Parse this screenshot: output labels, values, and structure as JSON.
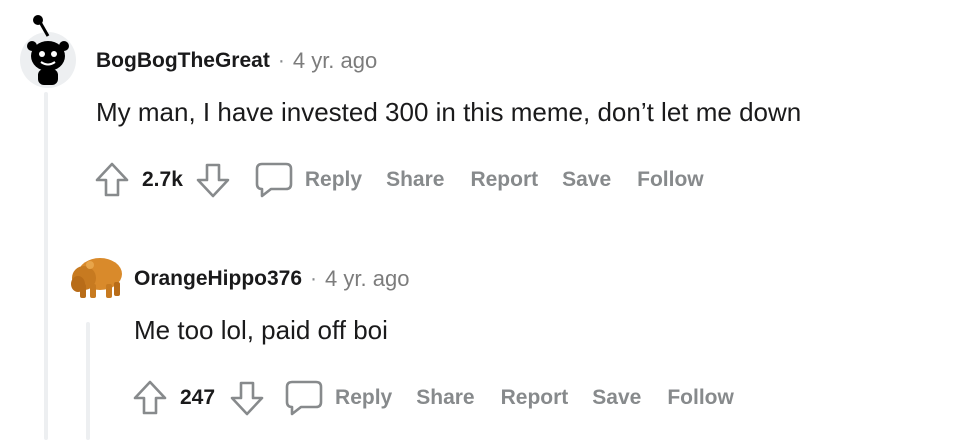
{
  "comments": [
    {
      "username": "BogBogTheGreat",
      "separator": "·",
      "timestamp": "4 yr. ago",
      "body": "My man, I have invested 300 in this meme, don’t let me down",
      "votes": "2.7k",
      "actions": {
        "reply": "Reply",
        "share": "Share",
        "report": "Report",
        "save": "Save",
        "follow": "Follow"
      }
    },
    {
      "username": "OrangeHippo376",
      "separator": "·",
      "timestamp": "4 yr. ago",
      "body": "Me too lol, paid off boi",
      "votes": "247",
      "actions": {
        "reply": "Reply",
        "share": "Share",
        "report": "Report",
        "save": "Save",
        "follow": "Follow"
      }
    }
  ],
  "icons": {
    "upvote": "upvote-arrow-icon",
    "downvote": "downvote-arrow-icon",
    "reply": "speech-bubble-icon"
  },
  "colors": {
    "text": "#1a1a1b",
    "muted": "#878a8c",
    "thread_line": "#edeff1",
    "hippo": "#d98a2b"
  }
}
